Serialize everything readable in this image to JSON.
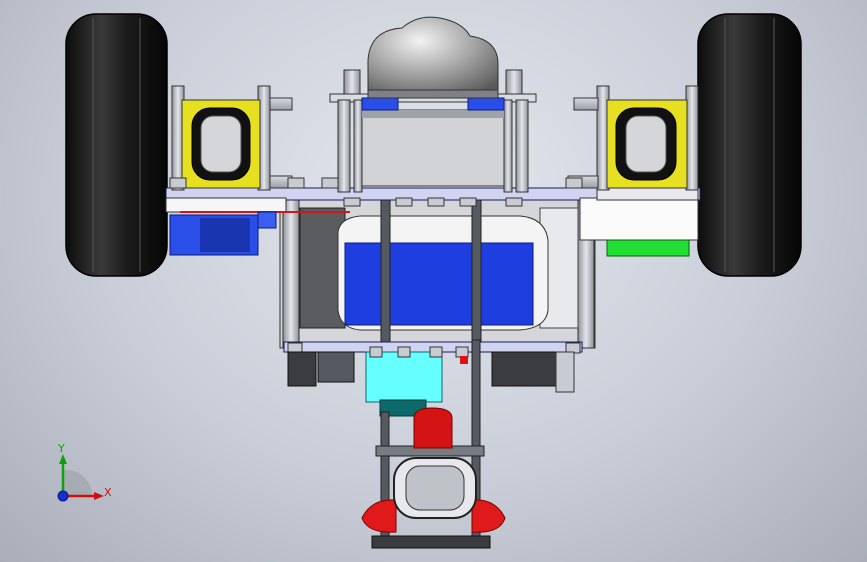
{
  "viewport": {
    "view": "front",
    "background_top": "#e3e7ee",
    "background_bottom": "#a9aeb9"
  },
  "triad": {
    "x_label": "X",
    "y_label": "Y",
    "x_color": "#d01010",
    "y_color": "#10a010",
    "z_color": "#1030d0"
  },
  "model": {
    "parts": [
      "left-wheel",
      "right-wheel",
      "dome-cover",
      "top-plate",
      "left-motor-bracket",
      "right-motor-bracket",
      "battery-pack",
      "mid-plate",
      "control-board",
      "caster-assembly",
      "green-module"
    ],
    "colors": {
      "tire": "#1a1a1a",
      "bracket": "#e6e020",
      "battery": "#1f3ee0",
      "board": "#66ffff",
      "module": "#22dd33",
      "caster": "#dd1111",
      "metal": "#b8bcc4"
    }
  }
}
